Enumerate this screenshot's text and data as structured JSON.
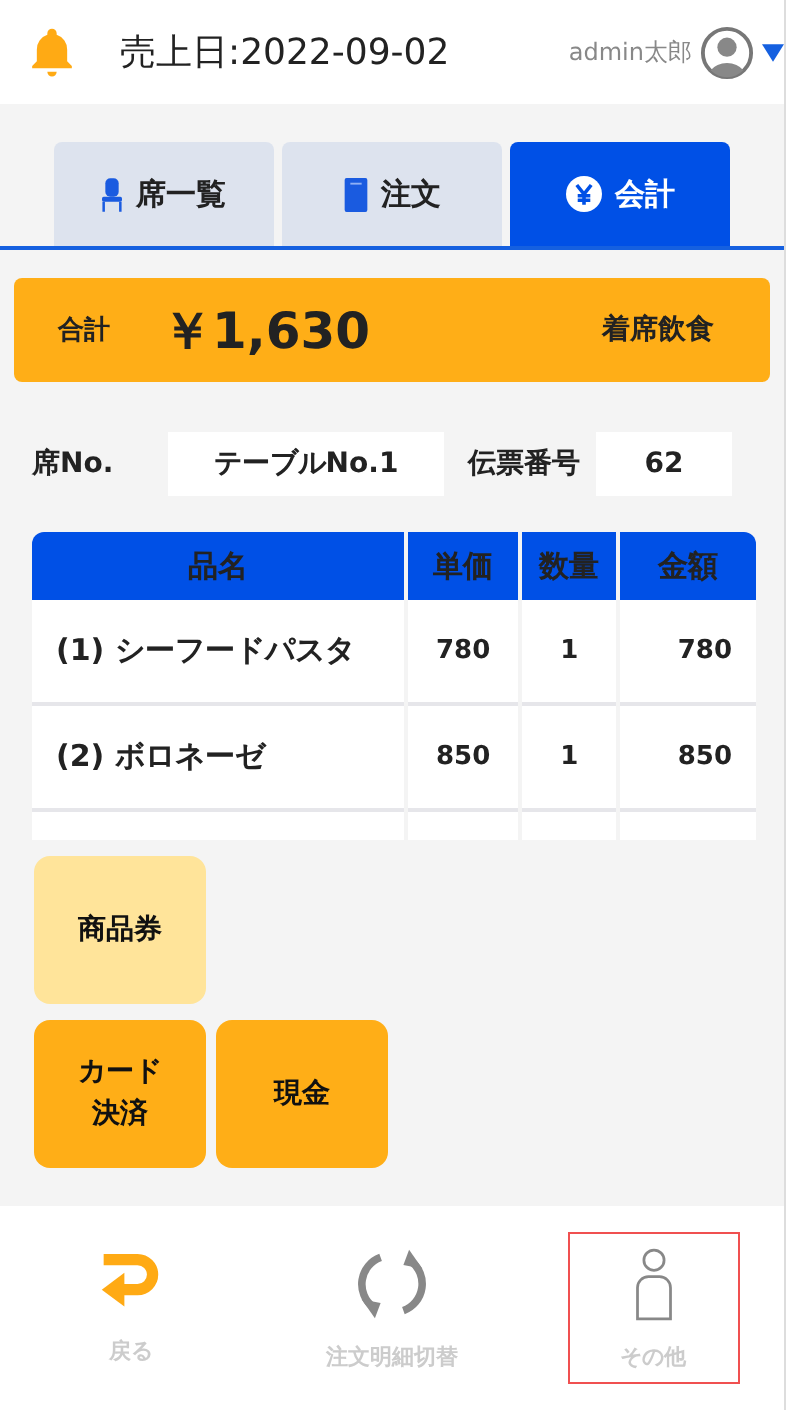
{
  "header": {
    "sales_date": "売上日:2022-09-02",
    "user": "admin太郎"
  },
  "tabs": [
    {
      "label": "席一覧",
      "selected": false
    },
    {
      "label": "注文",
      "selected": false
    },
    {
      "label": "会計",
      "selected": true
    }
  ],
  "total": {
    "label": "合計",
    "amount": "￥1,630",
    "dining": "着席飲食"
  },
  "slip": {
    "seat_label": "席No.",
    "seat_value": "テーブルNo.1",
    "slip_label": "伝票番号",
    "slip_value": "62"
  },
  "table": {
    "columns": [
      "品名",
      "単価",
      "数量",
      "金額"
    ],
    "rows": [
      [
        "(1) シーフードパスタ",
        "780",
        "1",
        "780"
      ],
      [
        "(2) ボロネーゼ",
        "850",
        "1",
        "850"
      ]
    ]
  },
  "payments": [
    {
      "label": "商品券",
      "kind": "voucher"
    },
    {
      "label": "カード決済",
      "kind": "standard"
    },
    {
      "label": "現金",
      "kind": "standard"
    }
  ],
  "bottom_nav": [
    {
      "label": "戻る",
      "focused": false
    },
    {
      "label": "注文明細切替",
      "focused": false
    },
    {
      "label": "その他",
      "focused": true
    }
  ]
}
